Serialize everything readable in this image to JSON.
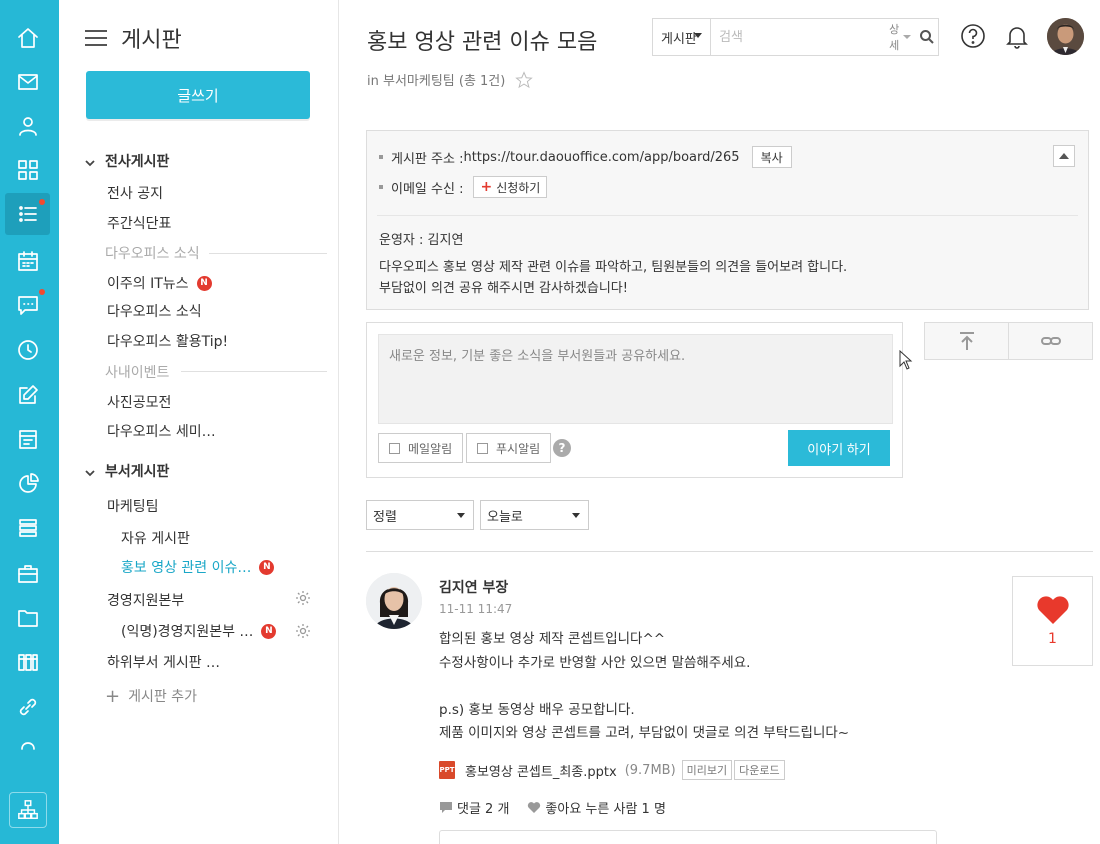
{
  "rail": {
    "items": [
      {
        "name": "home-icon"
      },
      {
        "name": "mail-icon"
      },
      {
        "name": "contacts-icon"
      },
      {
        "name": "apps-icon"
      },
      {
        "name": "board-icon",
        "active": true,
        "dot": true
      },
      {
        "name": "calendar-icon"
      },
      {
        "name": "chat-icon",
        "dot": true
      },
      {
        "name": "clock-icon"
      },
      {
        "name": "edit-icon"
      },
      {
        "name": "report-icon"
      },
      {
        "name": "survey-icon"
      },
      {
        "name": "list-icon"
      },
      {
        "name": "briefcase-icon"
      },
      {
        "name": "folder-icon"
      },
      {
        "name": "library-icon"
      },
      {
        "name": "link-icon"
      }
    ],
    "org_icon": "org-chart-icon"
  },
  "sidebar": {
    "title": "게시판",
    "write_button": "글쓰기",
    "groups": {
      "company": "전사게시판",
      "department": "부서게시판"
    },
    "items": {
      "notice": "전사 공지",
      "menu": "주간식단표",
      "div_news": "다우오피스 소식",
      "it_news": "이주의 IT뉴스",
      "news": "다우오피스 소식",
      "tips": "다우오피스 활용Tip!",
      "div_event": "사내이벤트",
      "photo": "사진공모전",
      "seminar": "다우오피스 세미…",
      "marketing": "마케팅팀",
      "free": "자유 게시판",
      "promo": "홍보 영상 관련 이슈…",
      "mgmt": "경영지원본부",
      "anon": "(익명)경영지원본부 …",
      "sub": "하위부서 게시판 …",
      "add": "게시판 추가"
    },
    "new_badge": "N"
  },
  "header": {
    "title": "홍보 영상 관련 이슈 모음",
    "subtitle": "in 부서마케팅팀 (총 1건)",
    "search": {
      "scope": "게시판",
      "placeholder": "검색",
      "detail": "상세"
    }
  },
  "info": {
    "address_label": "게시판 주소 :",
    "address_value": "https://tour.daouoffice.com/app/board/265",
    "copy": "복사",
    "email_label": "이메일 수신 :",
    "subscribe": "신청하기",
    "operator": "운영자 : 김지연",
    "desc1": "다우오피스 홍보 영상 제작 관련 이슈를 파악하고, 팀원분들의 의견을 들어보려 합니다.",
    "desc2": "부담없이 의견 공유 해주시면 감사하겠습니다!"
  },
  "composer": {
    "placeholder": "새로운 정보, 기분 좋은 소식을 부서원들과 공유하세요.",
    "mail_alert": "메일알림",
    "push_alert": "푸시알림",
    "help": "?",
    "submit": "이야기 하기"
  },
  "sort": {
    "order": "정렬",
    "date": "오늘로"
  },
  "post": {
    "author": "김지연 부장",
    "date": "11-11 11:47",
    "lines": [
      "합의된 홍보 영상 제작 콘셉트입니다^^",
      "수정사항이나 추가로 반영할 사안 있으면 말씀해주세요.",
      "",
      "p.s) 홍보 동영상 배우 공모합니다.",
      "제품 이미지와 영상 콘셉트를 고려, 부담없이 댓글로 의견 부탁드립니다~"
    ],
    "likes": "1",
    "attachment": {
      "icon_label": "PPT",
      "name": "홍보영상 콘셉트_최종.pptx",
      "size": "(9.7MB)",
      "preview": "미리보기",
      "download": "다운로드"
    },
    "comments": "댓글 2 개",
    "liked_by": "좋아요 누른 사람 1 명"
  },
  "colors": {
    "accent": "#2bbad8",
    "rail": "#26b8d6",
    "badge": "#e33a2f",
    "heart": "#e8392c"
  }
}
